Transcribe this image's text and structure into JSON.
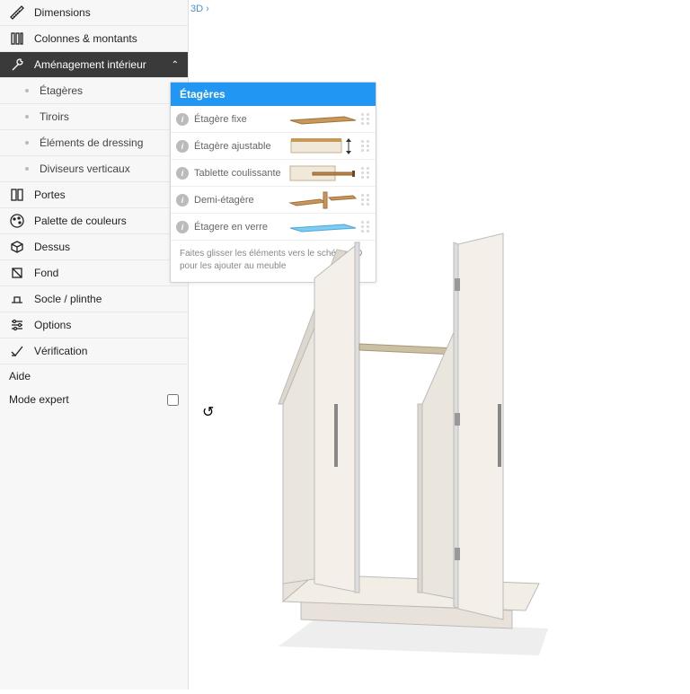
{
  "breadcrumb": {
    "label": "3D",
    "sep": "›"
  },
  "sidebar": {
    "dimensions": "Dimensions",
    "columns": "Colonnes & montants",
    "interior": "Aménagement intérieur",
    "shelves": "Étagères",
    "drawers": "Tiroirs",
    "dressing": "Éléments de dressing",
    "dividers": "Diviseurs verticaux",
    "doors": "Portes",
    "palette": "Palette de couleurs",
    "top": "Dessus",
    "back": "Fond",
    "base": "Socle / plinthe",
    "options": "Options",
    "verification": "Vérification",
    "help": "Aide",
    "expert": "Mode expert"
  },
  "popup": {
    "title": "Étagères",
    "items": {
      "fixed": "Étagère fixe",
      "adjustable": "Étagère ajustable",
      "sliding": "Tablette coulissante",
      "half": "Demi-étagère",
      "glass": "Étagere en verre"
    },
    "hint": "Faites glisser les éléments vers le schéma 2D pour les ajouter au meuble"
  }
}
